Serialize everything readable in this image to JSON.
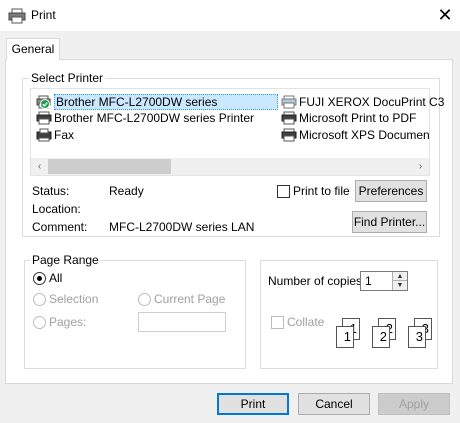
{
  "window": {
    "title": "Print",
    "close_glyph": "✕"
  },
  "tabs": [
    {
      "label": "General"
    }
  ],
  "select_printer": {
    "group_title": "Select Printer",
    "printers": [
      {
        "name": "Brother MFC-L2700DW series",
        "icon": "printer-default-icon",
        "selected": true
      },
      {
        "name": "Brother MFC-L2700DW series Printer",
        "icon": "printer-icon"
      },
      {
        "name": "Fax",
        "icon": "fax-icon"
      },
      {
        "name": "FUJI XEROX DocuPrint C3",
        "icon": "printer-network-icon"
      },
      {
        "name": "Microsoft Print to PDF",
        "icon": "printer-icon"
      },
      {
        "name": "Microsoft XPS Documen",
        "icon": "printer-icon"
      }
    ],
    "scroll_left": "‹",
    "scroll_right": "›",
    "status_label": "Status:",
    "status_value": "Ready",
    "location_label": "Location:",
    "location_value": "",
    "comment_label": "Comment:",
    "comment_value": "MFC-L2700DW series LAN",
    "print_to_file_label": "Print to file",
    "print_to_file_checked": false,
    "preferences_label": "Preferences",
    "find_printer_label": "Find Printer..."
  },
  "page_range": {
    "group_title": "Page Range",
    "all_label": "All",
    "selection_label": "Selection",
    "current_page_label": "Current Page",
    "pages_label": "Pages:",
    "pages_value": "",
    "selected": "all"
  },
  "copies": {
    "label": "Number of copies:",
    "value": "1",
    "collate_label": "Collate",
    "collate_checked": false,
    "collate_pages": [
      "1",
      "1",
      "2",
      "2",
      "3",
      "3"
    ]
  },
  "buttons": {
    "print": "Print",
    "cancel": "Cancel",
    "apply": "Apply"
  },
  "colors": {
    "accent": "#0078d7",
    "selection": "#cce8ff",
    "dialog_bg": "#f0f0f0"
  }
}
